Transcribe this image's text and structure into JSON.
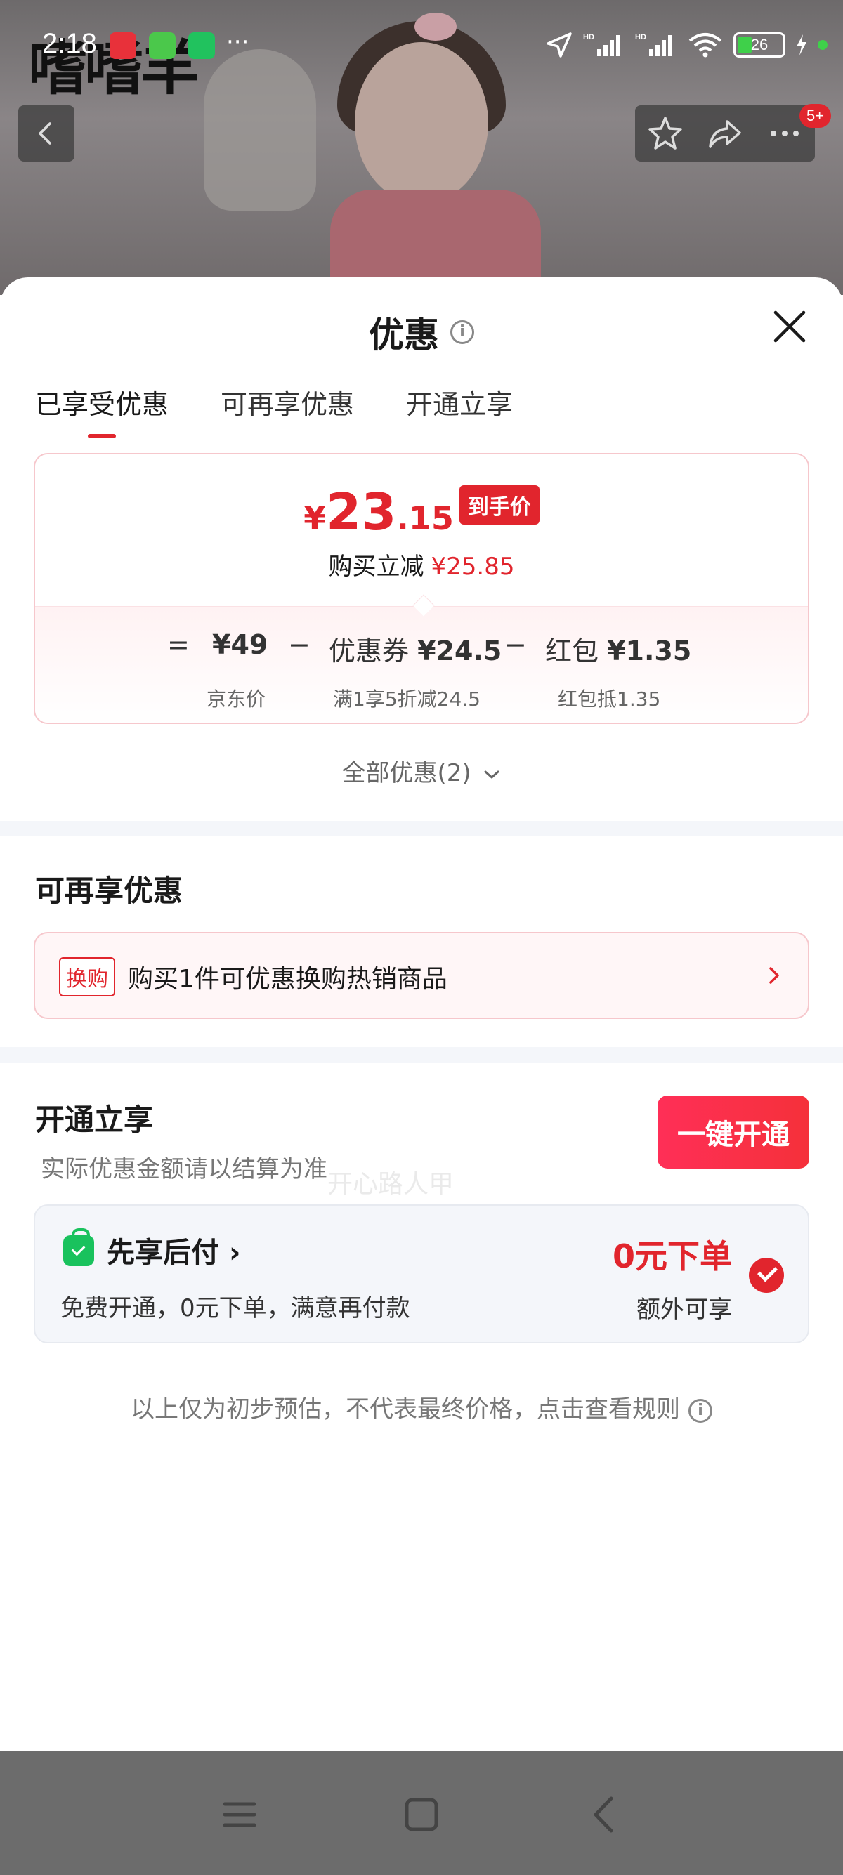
{
  "status_bar": {
    "time": "2:18",
    "more": "···",
    "battery_level": "26",
    "app_icons": [
      "taobao-app-icon",
      "green-bolt-app-icon",
      "wechat-app-icon"
    ]
  },
  "background_page": {
    "brand_text": "嗜嗜羊",
    "badge": "5+"
  },
  "sheet": {
    "title": "优惠",
    "tabs": [
      {
        "label": "已享受优惠",
        "active": true
      },
      {
        "label": "可再享优惠",
        "active": false
      },
      {
        "label": "开通立享",
        "active": false
      }
    ],
    "price_card": {
      "currency": "¥",
      "final_price_int": "23",
      "final_price_dec": ".15",
      "final_tag": "到手价",
      "reduce_label": "购买立减",
      "reduce_amount": "¥25.85",
      "formula": {
        "eq": "=",
        "jd_price": "¥49",
        "jd_price_label": "京东价",
        "minus1": "−",
        "coupon_label": "优惠券",
        "coupon_value": "¥24.5",
        "coupon_desc": "满1享5折减24.5",
        "minus2": "−",
        "hongbao_label": "红包",
        "hongbao_value": "¥1.35",
        "hongbao_desc": "红包抵1.35"
      }
    },
    "all_deals": "全部优惠(2)",
    "more_section": {
      "title": "可再享优惠",
      "tag": "换购",
      "text": "购买1件可优惠换购热销商品"
    },
    "open_section": {
      "title": "开通立享",
      "note": "实际优惠金额请以结算为准",
      "button": "一键开通",
      "pay_title": "先享后付",
      "pay_chevron": "›",
      "pay_desc": "免费开通，0元下单，满意再付款",
      "pay_highlight": "0元下单",
      "pay_extra": "额外可享"
    },
    "disclaimer": "以上仅为初步预估，不代表最终价格，点击查看规则",
    "watermark": "开心路人甲"
  },
  "colors": {
    "accent_red": "#e1252d",
    "tab_underline": "#e1252d",
    "pay_green": "#19c25d"
  }
}
